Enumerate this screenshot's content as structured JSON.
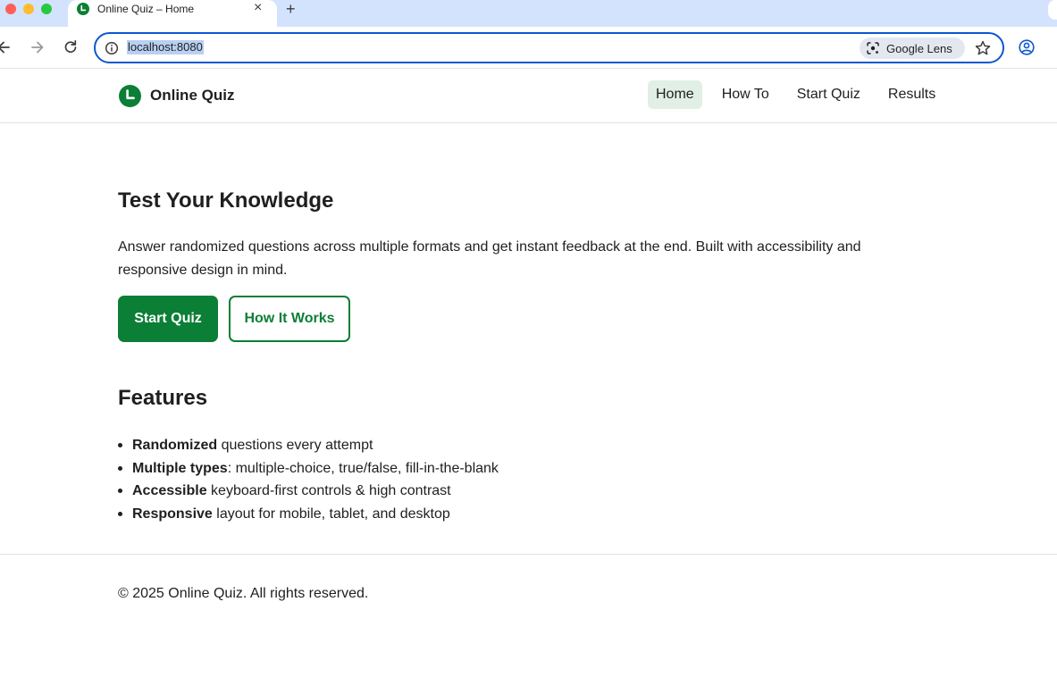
{
  "browser": {
    "tab_title": "Online Quiz – Home",
    "tab_close_glyph": "×",
    "new_tab_glyph": "+",
    "url": "localhost:8080",
    "lens_label": "Google Lens",
    "icons": [
      "back-icon",
      "forward-icon",
      "reload-icon",
      "site-info-icon",
      "google-lens-icon",
      "bookmark-star-icon",
      "account-icon",
      "close-icon",
      "plus-icon"
    ]
  },
  "header": {
    "brand_name": "Online Quiz",
    "nav": [
      {
        "label": "Home",
        "active": true
      },
      {
        "label": "How To",
        "active": false
      },
      {
        "label": "Start Quiz",
        "active": false
      },
      {
        "label": "Results",
        "active": false
      }
    ]
  },
  "hero": {
    "title": "Test Your Knowledge",
    "description": "Answer randomized questions across multiple formats and get instant feedback at the end. Built with accessibility and responsive design in mind.",
    "primary_button": "Start Quiz",
    "secondary_button": "How It Works"
  },
  "features": {
    "title": "Features",
    "items": [
      {
        "bold": "Randomized",
        "rest": " questions every attempt"
      },
      {
        "bold": "Multiple types",
        "rest": ": multiple-choice, true/false, fill-in-the-blank"
      },
      {
        "bold": "Accessible",
        "rest": " keyboard-first controls & high contrast"
      },
      {
        "bold": "Responsive",
        "rest": " layout for mobile, tablet, and desktop"
      }
    ]
  },
  "footer": {
    "text": "© 2025 Online Quiz. All rights reserved."
  },
  "colors": {
    "brand_green": "#0b7f35",
    "nav_active_bg": "#e1efe6",
    "omnibox_border": "#0b57d0",
    "tabstrip_bg": "#d3e3fd"
  }
}
